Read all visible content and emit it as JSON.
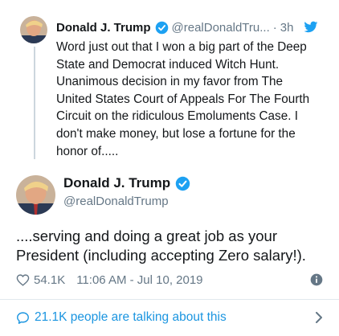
{
  "parent_tweet": {
    "author_name": "Donald J. Trump",
    "handle": "@realDonaldTru...",
    "separator": "·",
    "time": "3h",
    "text": "Word just out that I won a big part of the Deep\nState and Democrat induced Witch Hunt.\nUnanimous decision in my favor from The\nUnited States Court of Appeals For The Fourth\nCircuit on the ridiculous Emoluments Case. I\ndon't make money, but lose a fortune for the\nhonor of....."
  },
  "main_tweet": {
    "author_name": "Donald J. Trump",
    "handle": "@realDonaldTrump",
    "text": "....serving and doing a great job as your\nPresident (including accepting Zero salary!).",
    "likes": "54.1K",
    "timestamp": "11:06 AM - Jul 10, 2019"
  },
  "footer": {
    "talking_label": "21.1K people are talking about this"
  },
  "colors": {
    "accent": "#1b95e0",
    "verified": "#1da1f2",
    "muted": "#657786"
  },
  "icons": [
    "twitter-bird-icon",
    "verified-badge-icon",
    "heart-icon",
    "info-icon",
    "comment-bubble-icon",
    "chevron-right-icon"
  ]
}
